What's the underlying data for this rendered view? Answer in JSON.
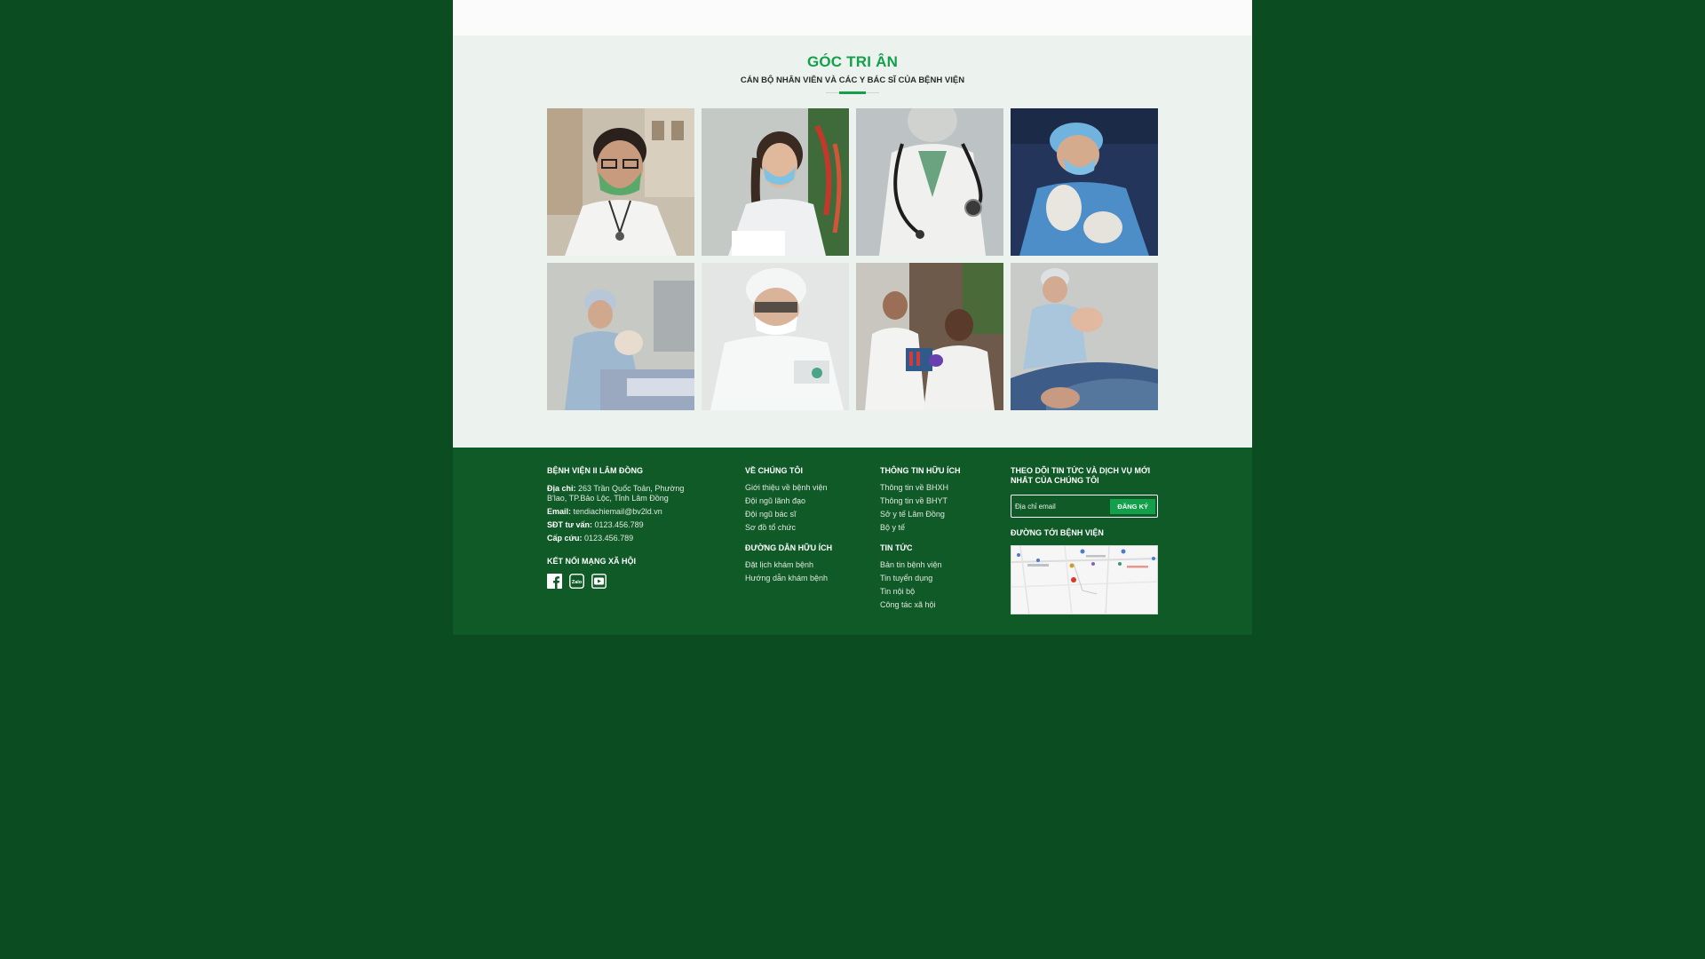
{
  "gratitude": {
    "title": "GÓC TRI ÂN",
    "subtitle": "CÁN BỘ NHÂN VIÊN VÀ CÁC Y BÁC SĨ CỦA BỆNH VIỆN",
    "photos": [
      "doctor-green-mask",
      "nurse-blue-mask",
      "doctor-stethoscope",
      "surgeon-gloves",
      "surgery-team",
      "surgeon-cap",
      "lab-researchers",
      "delivery-room"
    ]
  },
  "footer": {
    "hospital": {
      "name": "BỆNH VIỆN II LÂM ĐỒNG",
      "address_label": "Địa chỉ:",
      "address_line1": "263 Trần Quốc Toản, Phường",
      "address_line2": "B'lao, TP.Bảo Lộc, Tỉnh Lâm Đồng",
      "email_label": "Email:",
      "email_value": "tendiachiemail@bv2ld.vn",
      "phone_label": "SĐT tư vấn:",
      "phone_value": "0123.456.789",
      "emergency_label": "Cấp cứu:",
      "emergency_value": "0123.456.789"
    },
    "social": {
      "heading": "KẾT NỐI MẠNG XÃ HỘI",
      "icons": [
        "facebook-icon",
        "zalo-icon",
        "youtube-icon"
      ]
    },
    "about": {
      "heading": "VỀ CHÚNG TÔI",
      "links": [
        "Giới thiệu về bệnh viện",
        "Đội ngũ lãnh đạo",
        "Đội ngũ bác sĩ",
        "Sơ đồ tổ chức"
      ]
    },
    "guides": {
      "heading": "ĐƯỜNG DẪN HỮU ÍCH",
      "links": [
        "Đặt lịch khám bệnh",
        "Hướng dẫn khám bệnh"
      ]
    },
    "useful_info": {
      "heading": "THÔNG TIN HỮU ÍCH",
      "links": [
        "Thông tin về BHXH",
        "Thông tin về BHYT",
        "Sở y tế Lâm Đồng",
        "Bộ y tế"
      ]
    },
    "news": {
      "heading": "TIN TỨC",
      "links": [
        "Bản tin bệnh viện",
        "Tin tuyển dụng",
        "Tin nội bộ",
        "Công tác xã hội"
      ]
    },
    "subscribe": {
      "heading_line1": "THEO DÕI TIN TỨC VÀ DỊCH VỤ MỚI",
      "heading_line2": "NHẤT CỦA CHÚNG TÔI",
      "placeholder": "Địa chỉ email",
      "button": "ĐĂNG KÝ"
    },
    "map": {
      "heading": "ĐƯỜNG TỚI BỆNH VIỆN"
    }
  },
  "colors": {
    "page_bg": "#0b4d21",
    "footer_bg": "#0f5a26",
    "section_bg": "#ecf3ee",
    "accent": "#13a04a"
  }
}
